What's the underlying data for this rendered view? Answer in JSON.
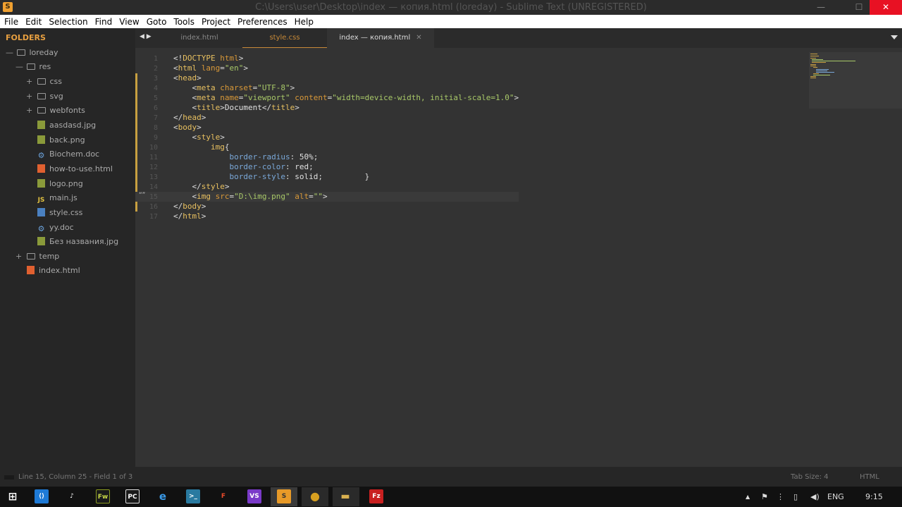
{
  "window": {
    "title": "C:\\Users\\user\\Desktop\\index — копия.html (loreday) - Sublime Text (UNREGISTERED)",
    "min": "—",
    "max": "☐",
    "close": "✕"
  },
  "menu": [
    "File",
    "Edit",
    "Selection",
    "Find",
    "View",
    "Goto",
    "Tools",
    "Project",
    "Preferences",
    "Help"
  ],
  "sidebar": {
    "header": "FOLDERS",
    "items": [
      {
        "label": "loreday",
        "toggle": "—"
      },
      {
        "label": "res",
        "toggle": "—"
      },
      {
        "label": "css",
        "toggle": "+"
      },
      {
        "label": "svg",
        "toggle": "+"
      },
      {
        "label": "webfonts",
        "toggle": "+"
      },
      {
        "label": "aasdasd.jpg"
      },
      {
        "label": "back.png"
      },
      {
        "label": "Biochem.doc"
      },
      {
        "label": "how-to-use.html"
      },
      {
        "label": "logo.png"
      },
      {
        "label": "main.js",
        "icon_text": "JS"
      },
      {
        "label": "style.css"
      },
      {
        "label": "yy.doc"
      },
      {
        "label": "Без названия.jpg"
      },
      {
        "label": "temp",
        "toggle": "+"
      },
      {
        "label": "index.html"
      }
    ]
  },
  "tabs": {
    "nav": "◀ ▶",
    "items": [
      "index.html",
      "style.css",
      "index — копия.html"
    ],
    "close": "✕"
  },
  "editor": {
    "line_numbers": [
      "1",
      "2",
      "3",
      "4",
      "5",
      "6",
      "7",
      "8",
      "9",
      "10",
      "11",
      "12",
      "13",
      "14",
      "15",
      "16",
      "17"
    ],
    "current_line_marker": "“”",
    "tokens": {
      "l1": [
        "<!",
        "DOCTYPE",
        " html",
        ">"
      ],
      "l2": [
        "<",
        "html",
        " lang",
        "=",
        "\"en\"",
        ">"
      ],
      "l3": [
        "<",
        "head",
        ">"
      ],
      "l4": [
        "    <",
        "meta",
        " charset",
        "=",
        "\"UTF-8\"",
        ">"
      ],
      "l5": [
        "    <",
        "meta",
        " name",
        "=",
        "\"viewport\"",
        " content",
        "=",
        "\"width=device-width, initial-scale=1.0\"",
        ">"
      ],
      "l6": [
        "    <",
        "title",
        ">",
        "Document",
        "</",
        "title",
        ">"
      ],
      "l7": [
        "</",
        "head",
        ">"
      ],
      "l8": [
        "<",
        "body",
        ">"
      ],
      "l9": [
        "    <",
        "style",
        ">"
      ],
      "l10": [
        "        ",
        "img",
        "{"
      ],
      "l11": [
        "            ",
        "border-radius",
        ": ",
        "50%",
        ";"
      ],
      "l12": [
        "            ",
        "border-color",
        ": ",
        "red",
        ";"
      ],
      "l13": [
        "            ",
        "border-style",
        ": ",
        "solid",
        ";",
        "         }"
      ],
      "l14": [
        "    </",
        "style",
        ">"
      ],
      "l15": [
        "    <",
        "img",
        " src",
        "=",
        "\"D:\\img.png\"",
        " alt",
        "=",
        "\"\"",
        ">"
      ],
      "l16": [
        "</",
        "body",
        ">"
      ],
      "l17": [
        "</",
        "html",
        ">"
      ]
    }
  },
  "status": {
    "position": "Line 15, Column 25 - Field 1 of 3",
    "tab_size": "Tab Size: 4",
    "syntax": "HTML"
  },
  "taskbar": {
    "apps": [
      {
        "name": "windows-start",
        "text": "⊞",
        "color": "#111111"
      },
      {
        "name": "vscode",
        "text": "⟨⟩",
        "color": "#1e7ad6"
      },
      {
        "name": "tiktok",
        "text": "♪",
        "color": "#111111"
      },
      {
        "name": "fireworks",
        "text": "Fw",
        "color": "#8a9a20"
      },
      {
        "name": "pycharm",
        "text": "PC",
        "color": "#1a1a1a"
      },
      {
        "name": "edge",
        "text": "e",
        "color": "#1a6fc8"
      },
      {
        "name": "terminal",
        "text": ">_",
        "color": "#2a7aa0"
      },
      {
        "name": "figma",
        "text": "F",
        "color": "#222222"
      },
      {
        "name": "visual-studio",
        "text": "VS",
        "color": "#7a3ac8"
      },
      {
        "name": "sublime",
        "text": "S",
        "color": "#e89a28"
      },
      {
        "name": "chrome",
        "text": "●",
        "color": "#d8a020"
      },
      {
        "name": "explorer",
        "text": "▬",
        "color": "#d8b050"
      },
      {
        "name": "filezilla",
        "text": "Fz",
        "color": "#c82020"
      }
    ],
    "tray": {
      "chevron": "▲",
      "lang": "ENG",
      "time": "9:15"
    }
  }
}
